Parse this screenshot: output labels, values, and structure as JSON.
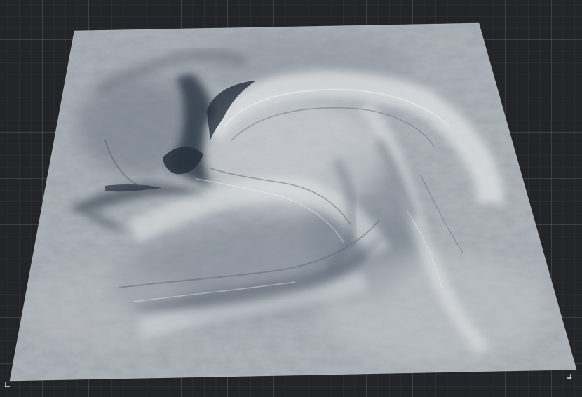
{
  "viewport": {
    "background": "#232427",
    "grid_color": "#3a3b3f"
  },
  "terrain": {
    "base_color": "#a7adb3",
    "shadow_color": "#313a46",
    "highlight_color": "#dfe1e2"
  },
  "icons": {
    "corner_markers": "corner-marker-icon"
  }
}
